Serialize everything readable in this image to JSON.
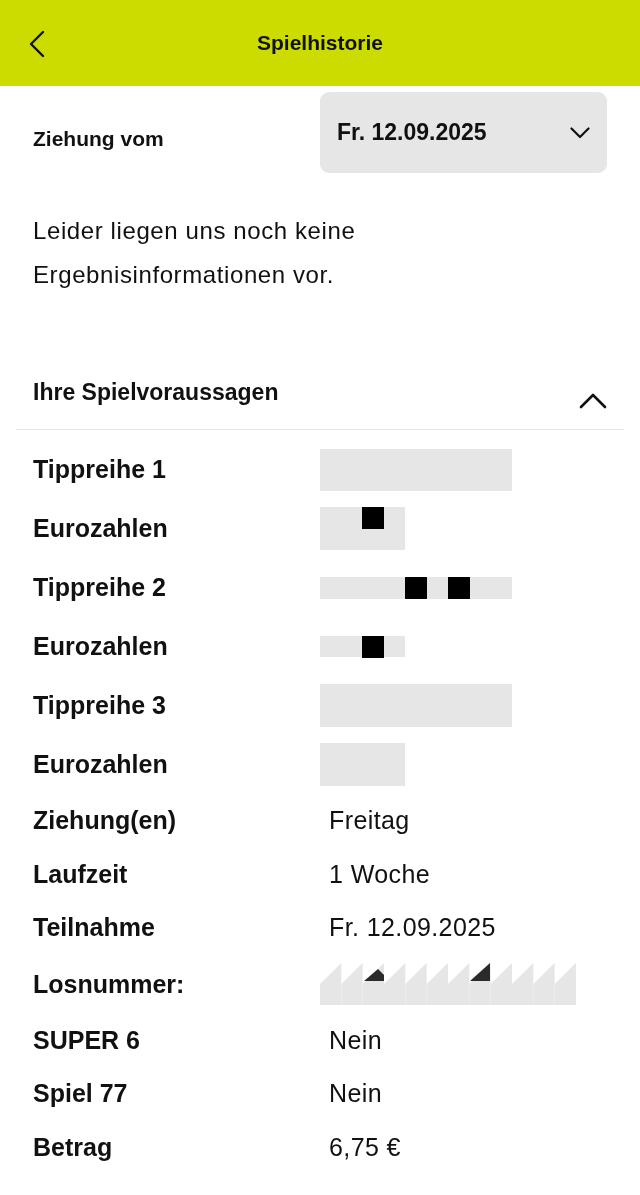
{
  "header": {
    "title": "Spielhistorie"
  },
  "draw_date": {
    "label": "Ziehung vom",
    "value": "Fr. 12.09.2025"
  },
  "message": "Leider liegen uns noch keine Ergebnisinformationen vor.",
  "predictions": {
    "title": "Ihre Spielvoraussagen",
    "expanded": true,
    "rows": [
      {
        "label": "Tippreihe 1",
        "kind": "mask"
      },
      {
        "label": "Eurozahlen",
        "kind": "mask"
      },
      {
        "label": "Tippreihe 2",
        "kind": "mask"
      },
      {
        "label": "Eurozahlen",
        "kind": "mask"
      },
      {
        "label": "Tippreihe 3",
        "kind": "mask"
      },
      {
        "label": "Eurozahlen",
        "kind": "mask"
      },
      {
        "label": "Ziehung(en)",
        "kind": "text",
        "value": "Freitag"
      },
      {
        "label": "Laufzeit",
        "kind": "text",
        "value": "1 Woche"
      },
      {
        "label": "Teilnahme",
        "kind": "text",
        "value": "Fr. 12.09.2025"
      },
      {
        "label": "Losnummer:",
        "kind": "pattern"
      },
      {
        "label": "SUPER 6",
        "kind": "text",
        "value": "Nein"
      },
      {
        "label": "Spiel 77",
        "kind": "text",
        "value": "Nein"
      },
      {
        "label": "Betrag",
        "kind": "text",
        "value": "6,75 €"
      }
    ]
  }
}
